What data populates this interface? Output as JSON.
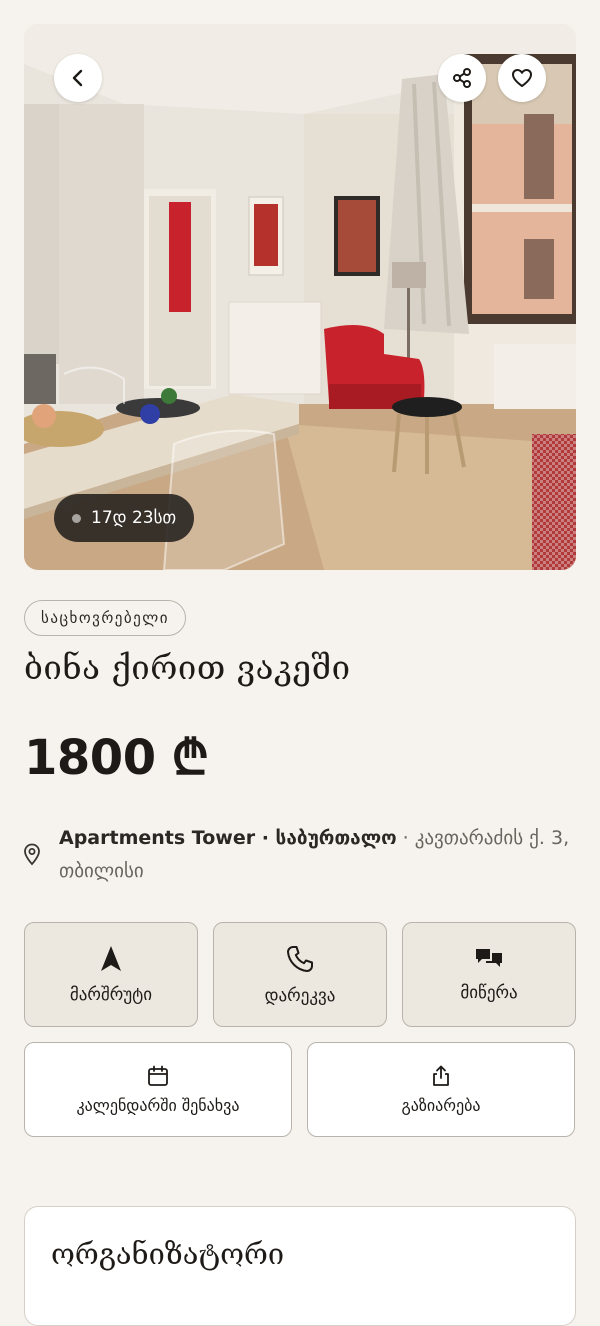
{
  "hero": {
    "time_label": "17დ 23სთ",
    "icons": {
      "back": "chevron-left-icon",
      "share": "share-icon",
      "favorite": "heart-icon"
    }
  },
  "listing": {
    "category": "საცხოვრებელი",
    "title": "ბინა ქირით ვაკეში",
    "price": "1800 ₾"
  },
  "location": {
    "icon": "map-pin-icon",
    "venue": "Apartments Tower · საბურთალო",
    "address": " · კავთარაძის ქ. 3, თბილისი"
  },
  "actions": {
    "route": {
      "label": "მარშრუტი",
      "icon": "navigation-arrow-icon"
    },
    "call": {
      "label": "დარეკვა",
      "icon": "phone-icon"
    },
    "message": {
      "label": "მიწერა",
      "icon": "chat-icon"
    },
    "calendar": {
      "label": "კალენდარში შენახვა",
      "icon": "calendar-icon"
    },
    "share": {
      "label": "გაზიარება",
      "icon": "share-upload-icon"
    }
  },
  "organizer": {
    "heading": "ორგანიზატორი"
  },
  "colors": {
    "background": "#f6f3ee",
    "accent_red": "#c8232c",
    "text": "#1d1a17",
    "muted": "#6a645e"
  }
}
